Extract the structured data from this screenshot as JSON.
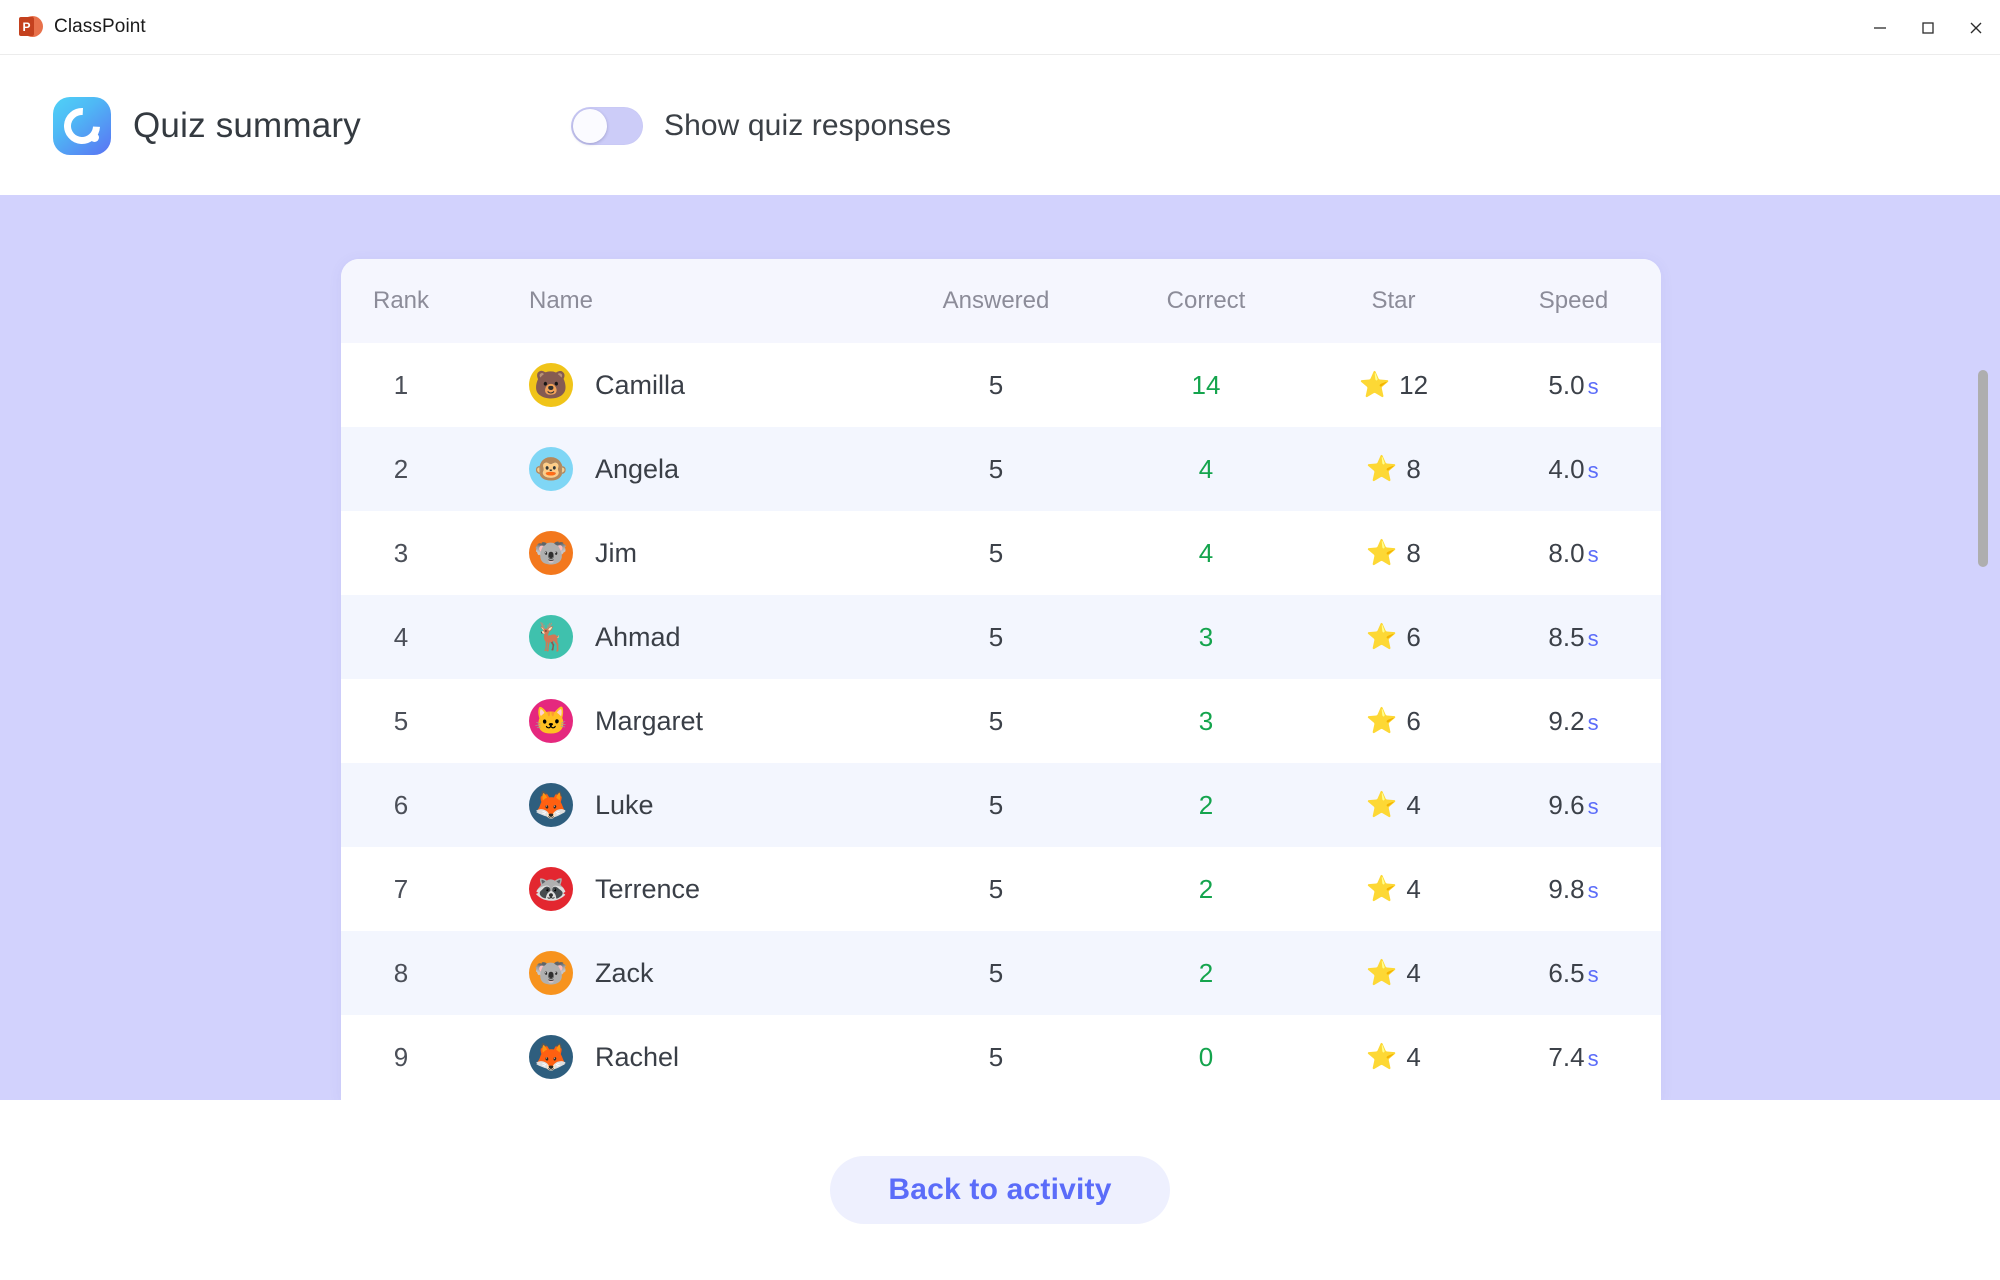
{
  "window": {
    "app_name": "ClassPoint",
    "app_icon": "powerpoint-icon",
    "ppt_letter": "P",
    "minimize_label": "Minimize",
    "maximize_label": "Maximize",
    "close_label": "Close"
  },
  "header": {
    "logo_icon": "classpoint-logo-icon",
    "title": "Quiz summary",
    "toggle": {
      "label": "Show quiz responses",
      "state": "off"
    }
  },
  "table": {
    "columns": [
      "Rank",
      "Name",
      "Answered",
      "Correct",
      "Star",
      "Speed"
    ],
    "star_icon": "star-icon",
    "speed_unit": "s",
    "rows": [
      {
        "rank": "1",
        "name": "Camilla",
        "avatar_icon": "bear-avatar",
        "emoji": "🐻",
        "bg": "#f0c419",
        "answered": "5",
        "correct": "14",
        "star": "12",
        "speed": "5.0"
      },
      {
        "rank": "2",
        "name": "Angela",
        "avatar_icon": "monkey-avatar",
        "emoji": "🐵",
        "bg": "#7fd6f5",
        "answered": "5",
        "correct": "4",
        "star": "8",
        "speed": "4.0"
      },
      {
        "rank": "3",
        "name": "Jim",
        "avatar_icon": "koala-avatar",
        "emoji": "🐨",
        "bg": "#f3781d",
        "answered": "5",
        "correct": "4",
        "star": "8",
        "speed": "8.0"
      },
      {
        "rank": "4",
        "name": "Ahmad",
        "avatar_icon": "deer-avatar",
        "emoji": "🦌",
        "bg": "#3fc1ad",
        "answered": "5",
        "correct": "3",
        "star": "6",
        "speed": "8.5"
      },
      {
        "rank": "5",
        "name": "Margaret",
        "avatar_icon": "cat-avatar",
        "emoji": "🐱",
        "bg": "#e5287e",
        "answered": "5",
        "correct": "3",
        "star": "6",
        "speed": "9.2"
      },
      {
        "rank": "6",
        "name": "Luke",
        "avatar_icon": "fox-avatar",
        "emoji": "🦊",
        "bg": "#2e5e7e",
        "answered": "5",
        "correct": "2",
        "star": "4",
        "speed": "9.6"
      },
      {
        "rank": "7",
        "name": "Terrence",
        "avatar_icon": "raccoon-avatar",
        "emoji": "🦝",
        "bg": "#e32730",
        "answered": "5",
        "correct": "2",
        "star": "4",
        "speed": "9.8"
      },
      {
        "rank": "8",
        "name": "Zack",
        "avatar_icon": "koala-avatar",
        "emoji": "🐨",
        "bg": "#f7931e",
        "answered": "5",
        "correct": "2",
        "star": "4",
        "speed": "6.5"
      },
      {
        "rank": "9",
        "name": "Rachel",
        "avatar_icon": "fox-avatar",
        "emoji": "🦊",
        "bg": "#2e5e7e",
        "answered": "5",
        "correct": "0",
        "star": "4",
        "speed": "7.4"
      }
    ]
  },
  "footer": {
    "back_button": "Back to activity"
  },
  "colors": {
    "stage_bg": "#d2d2fd",
    "accent": "#5b6cf9",
    "correct_green": "#14a44d",
    "header_row_bg": "#f5f6fe",
    "alt_row_bg": "#f3f6fe",
    "toggle_track": "#ccccf8",
    "scrollbar_thumb": "#aeaeae"
  }
}
